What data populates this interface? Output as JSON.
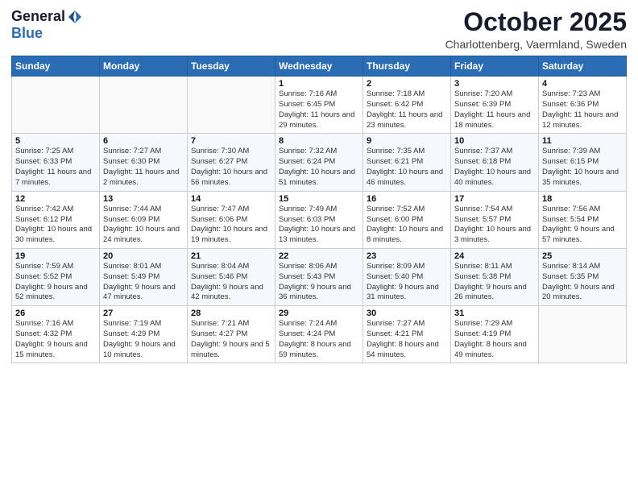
{
  "header": {
    "logo_general": "General",
    "logo_blue": "Blue",
    "month_title": "October 2025",
    "subtitle": "Charlottenberg, Vaermland, Sweden"
  },
  "days_of_week": [
    "Sunday",
    "Monday",
    "Tuesday",
    "Wednesday",
    "Thursday",
    "Friday",
    "Saturday"
  ],
  "weeks": [
    [
      {
        "day": "",
        "sunrise": "",
        "sunset": "",
        "daylight": ""
      },
      {
        "day": "",
        "sunrise": "",
        "sunset": "",
        "daylight": ""
      },
      {
        "day": "",
        "sunrise": "",
        "sunset": "",
        "daylight": ""
      },
      {
        "day": "1",
        "sunrise": "Sunrise: 7:16 AM",
        "sunset": "Sunset: 6:45 PM",
        "daylight": "Daylight: 11 hours and 29 minutes."
      },
      {
        "day": "2",
        "sunrise": "Sunrise: 7:18 AM",
        "sunset": "Sunset: 6:42 PM",
        "daylight": "Daylight: 11 hours and 23 minutes."
      },
      {
        "day": "3",
        "sunrise": "Sunrise: 7:20 AM",
        "sunset": "Sunset: 6:39 PM",
        "daylight": "Daylight: 11 hours and 18 minutes."
      },
      {
        "day": "4",
        "sunrise": "Sunrise: 7:23 AM",
        "sunset": "Sunset: 6:36 PM",
        "daylight": "Daylight: 11 hours and 12 minutes."
      }
    ],
    [
      {
        "day": "5",
        "sunrise": "Sunrise: 7:25 AM",
        "sunset": "Sunset: 6:33 PM",
        "daylight": "Daylight: 11 hours and 7 minutes."
      },
      {
        "day": "6",
        "sunrise": "Sunrise: 7:27 AM",
        "sunset": "Sunset: 6:30 PM",
        "daylight": "Daylight: 11 hours and 2 minutes."
      },
      {
        "day": "7",
        "sunrise": "Sunrise: 7:30 AM",
        "sunset": "Sunset: 6:27 PM",
        "daylight": "Daylight: 10 hours and 56 minutes."
      },
      {
        "day": "8",
        "sunrise": "Sunrise: 7:32 AM",
        "sunset": "Sunset: 6:24 PM",
        "daylight": "Daylight: 10 hours and 51 minutes."
      },
      {
        "day": "9",
        "sunrise": "Sunrise: 7:35 AM",
        "sunset": "Sunset: 6:21 PM",
        "daylight": "Daylight: 10 hours and 46 minutes."
      },
      {
        "day": "10",
        "sunrise": "Sunrise: 7:37 AM",
        "sunset": "Sunset: 6:18 PM",
        "daylight": "Daylight: 10 hours and 40 minutes."
      },
      {
        "day": "11",
        "sunrise": "Sunrise: 7:39 AM",
        "sunset": "Sunset: 6:15 PM",
        "daylight": "Daylight: 10 hours and 35 minutes."
      }
    ],
    [
      {
        "day": "12",
        "sunrise": "Sunrise: 7:42 AM",
        "sunset": "Sunset: 6:12 PM",
        "daylight": "Daylight: 10 hours and 30 minutes."
      },
      {
        "day": "13",
        "sunrise": "Sunrise: 7:44 AM",
        "sunset": "Sunset: 6:09 PM",
        "daylight": "Daylight: 10 hours and 24 minutes."
      },
      {
        "day": "14",
        "sunrise": "Sunrise: 7:47 AM",
        "sunset": "Sunset: 6:06 PM",
        "daylight": "Daylight: 10 hours and 19 minutes."
      },
      {
        "day": "15",
        "sunrise": "Sunrise: 7:49 AM",
        "sunset": "Sunset: 6:03 PM",
        "daylight": "Daylight: 10 hours and 13 minutes."
      },
      {
        "day": "16",
        "sunrise": "Sunrise: 7:52 AM",
        "sunset": "Sunset: 6:00 PM",
        "daylight": "Daylight: 10 hours and 8 minutes."
      },
      {
        "day": "17",
        "sunrise": "Sunrise: 7:54 AM",
        "sunset": "Sunset: 5:57 PM",
        "daylight": "Daylight: 10 hours and 3 minutes."
      },
      {
        "day": "18",
        "sunrise": "Sunrise: 7:56 AM",
        "sunset": "Sunset: 5:54 PM",
        "daylight": "Daylight: 9 hours and 57 minutes."
      }
    ],
    [
      {
        "day": "19",
        "sunrise": "Sunrise: 7:59 AM",
        "sunset": "Sunset: 5:52 PM",
        "daylight": "Daylight: 9 hours and 52 minutes."
      },
      {
        "day": "20",
        "sunrise": "Sunrise: 8:01 AM",
        "sunset": "Sunset: 5:49 PM",
        "daylight": "Daylight: 9 hours and 47 minutes."
      },
      {
        "day": "21",
        "sunrise": "Sunrise: 8:04 AM",
        "sunset": "Sunset: 5:46 PM",
        "daylight": "Daylight: 9 hours and 42 minutes."
      },
      {
        "day": "22",
        "sunrise": "Sunrise: 8:06 AM",
        "sunset": "Sunset: 5:43 PM",
        "daylight": "Daylight: 9 hours and 36 minutes."
      },
      {
        "day": "23",
        "sunrise": "Sunrise: 8:09 AM",
        "sunset": "Sunset: 5:40 PM",
        "daylight": "Daylight: 9 hours and 31 minutes."
      },
      {
        "day": "24",
        "sunrise": "Sunrise: 8:11 AM",
        "sunset": "Sunset: 5:38 PM",
        "daylight": "Daylight: 9 hours and 26 minutes."
      },
      {
        "day": "25",
        "sunrise": "Sunrise: 8:14 AM",
        "sunset": "Sunset: 5:35 PM",
        "daylight": "Daylight: 9 hours and 20 minutes."
      }
    ],
    [
      {
        "day": "26",
        "sunrise": "Sunrise: 7:16 AM",
        "sunset": "Sunset: 4:32 PM",
        "daylight": "Daylight: 9 hours and 15 minutes."
      },
      {
        "day": "27",
        "sunrise": "Sunrise: 7:19 AM",
        "sunset": "Sunset: 4:29 PM",
        "daylight": "Daylight: 9 hours and 10 minutes."
      },
      {
        "day": "28",
        "sunrise": "Sunrise: 7:21 AM",
        "sunset": "Sunset: 4:27 PM",
        "daylight": "Daylight: 9 hours and 5 minutes."
      },
      {
        "day": "29",
        "sunrise": "Sunrise: 7:24 AM",
        "sunset": "Sunset: 4:24 PM",
        "daylight": "Daylight: 8 hours and 59 minutes."
      },
      {
        "day": "30",
        "sunrise": "Sunrise: 7:27 AM",
        "sunset": "Sunset: 4:21 PM",
        "daylight": "Daylight: 8 hours and 54 minutes."
      },
      {
        "day": "31",
        "sunrise": "Sunrise: 7:29 AM",
        "sunset": "Sunset: 4:19 PM",
        "daylight": "Daylight: 8 hours and 49 minutes."
      },
      {
        "day": "",
        "sunrise": "",
        "sunset": "",
        "daylight": ""
      }
    ]
  ]
}
